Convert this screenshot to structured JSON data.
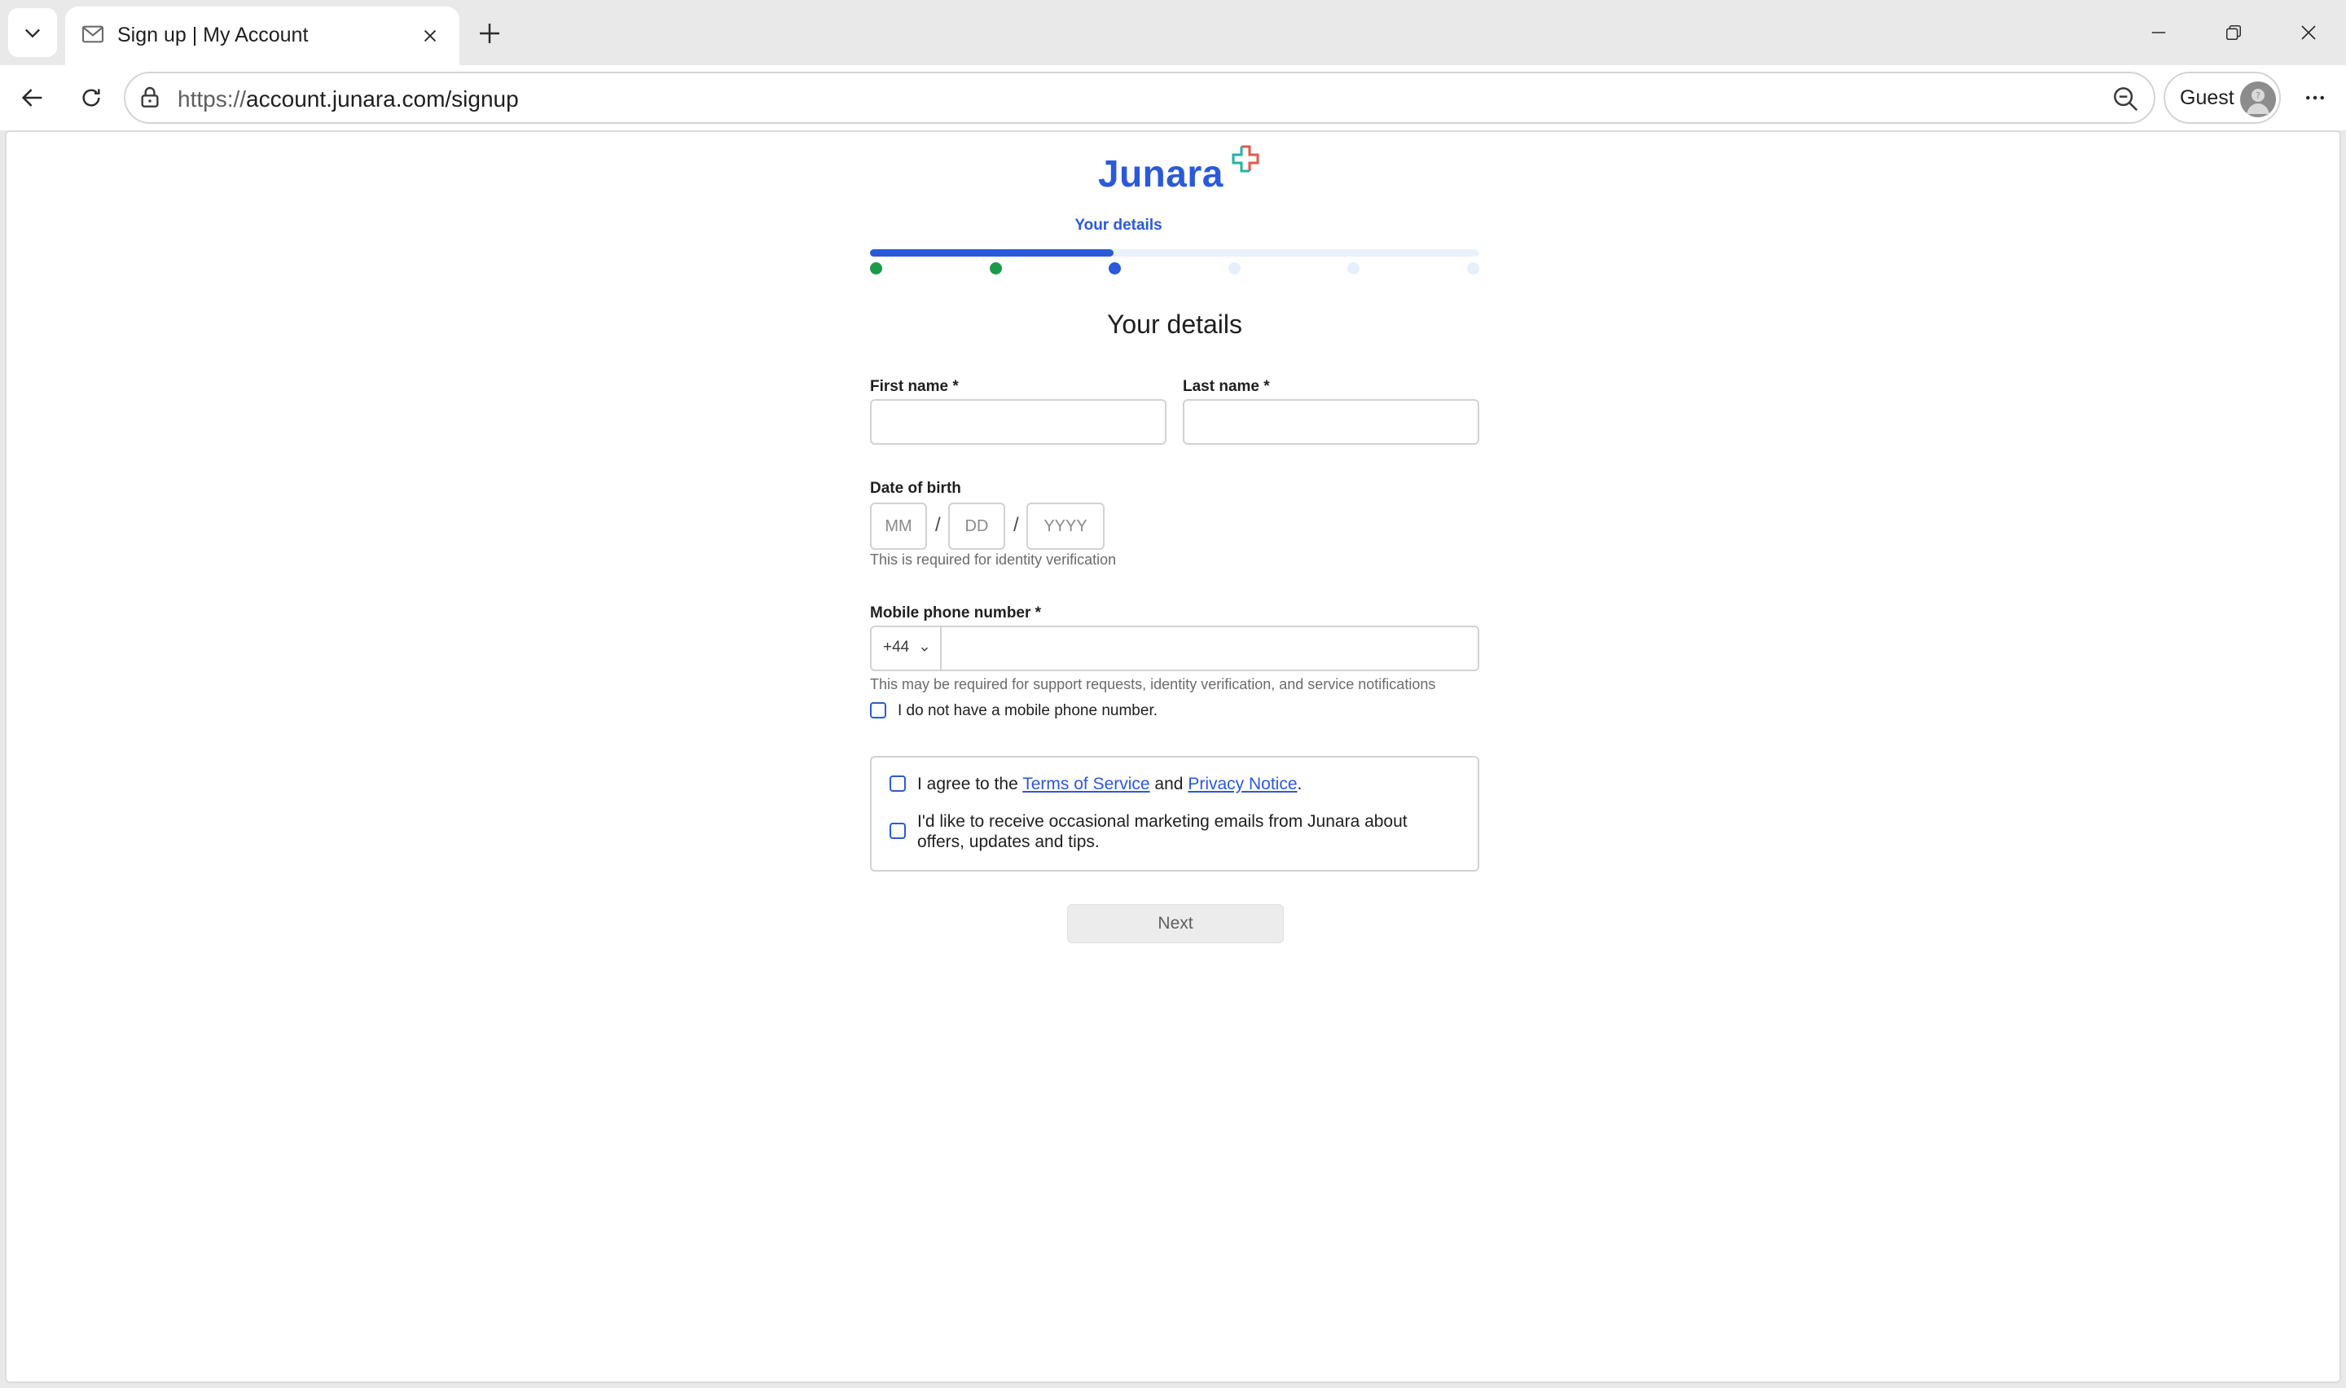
{
  "browser": {
    "tab_title": "Sign up | My Account",
    "url_protocol": "https://",
    "url_rest": "account.junara.com/signup",
    "profile_label": "Guest"
  },
  "page": {
    "logo_text": "Junara",
    "step_label": "Your details",
    "progress": {
      "total_steps": 6,
      "current_step": 3,
      "fill_fraction": 0.4
    },
    "form_title": "Your details",
    "first_name": {
      "label": "First name *",
      "value": ""
    },
    "last_name": {
      "label": "Last name *",
      "value": ""
    },
    "dob": {
      "label": "Date of birth",
      "month_placeholder": "MM",
      "day_placeholder": "DD",
      "year_placeholder": "YYYY",
      "separator": "/",
      "hint": "This is required for identity verification"
    },
    "phone": {
      "label": "Mobile phone number *",
      "country_code": "+44",
      "value": "",
      "hint": "This may be required for support requests, identity verification, and service notifications",
      "no_phone_label": "I do not have a mobile phone number."
    },
    "consent": {
      "agree_prefix": "I agree to the ",
      "terms_link": "Terms of Service",
      "agree_and": " and ",
      "privacy_link": "Privacy Notice",
      "agree_suffix": ".",
      "marketing_line1": "I'd like to receive occasional marketing emails from Junara about",
      "marketing_line2": "offers, updates and tips."
    },
    "next_button": "Next"
  },
  "colors": {
    "brand_blue": "#2b5ad8",
    "step_done_green": "#1a9b4a",
    "progress_track": "#eaf1fb"
  }
}
